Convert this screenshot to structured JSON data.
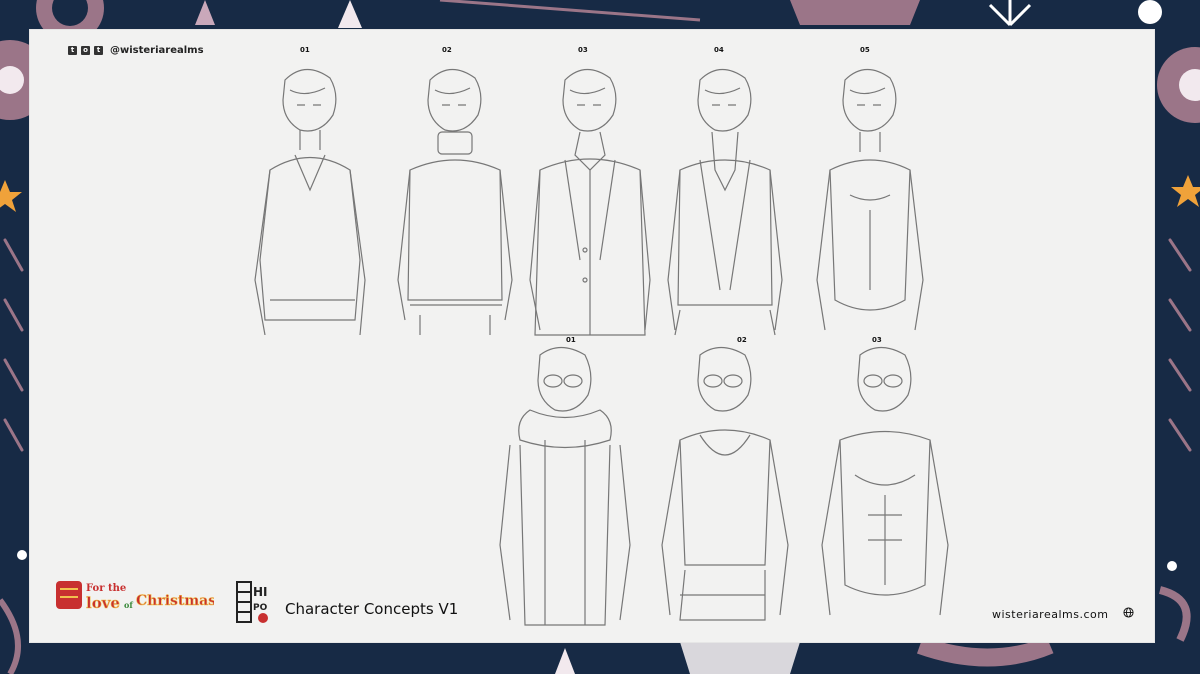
{
  "header": {
    "social_handle": "@wisteriarealms",
    "social_icons": [
      "twitter-icon",
      "instagram-icon",
      "tumblr-icon"
    ]
  },
  "concepts_row1": [
    {
      "label": "01"
    },
    {
      "label": "02"
    },
    {
      "label": "03"
    },
    {
      "label": "04"
    },
    {
      "label": "05"
    }
  ],
  "concepts_row2": [
    {
      "label": "01"
    },
    {
      "label": "02"
    },
    {
      "label": "03"
    }
  ],
  "footer": {
    "game_logo_text": "For the love of Christmas!",
    "title": "Character Concepts V1",
    "website": "wisteriarealms.com"
  },
  "colors": {
    "background": "#172a45",
    "paper": "#f2f2f1",
    "accent_pink": "#9b7588",
    "accent_orange": "#f0a23a"
  }
}
